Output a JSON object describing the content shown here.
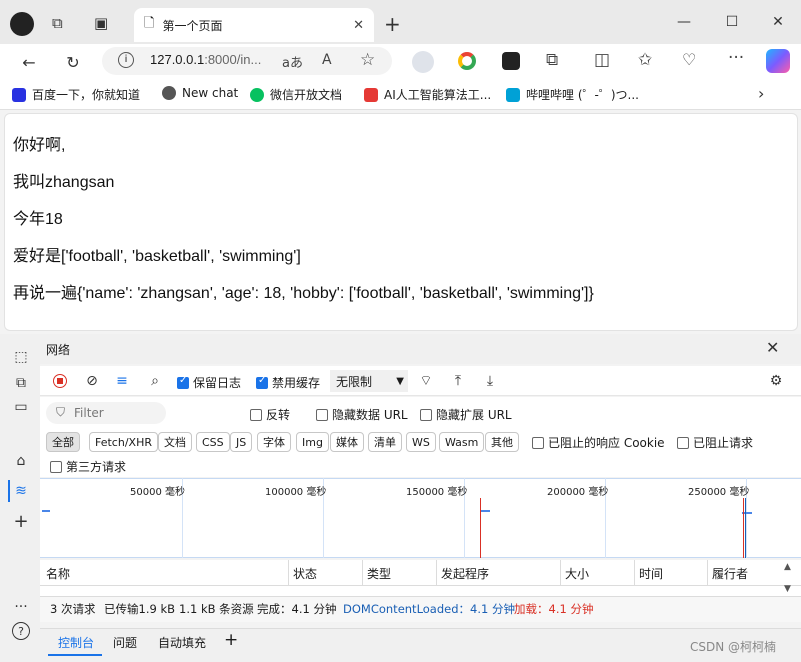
{
  "browser": {
    "tab_title": "第一个页面",
    "url_host": "127.0.0.1",
    "url_rest": ":8000/in...",
    "read_aloud_label": "aあ",
    "text_size_label": "A",
    "bookmarks": [
      {
        "label": "百度一下，你就知道",
        "color": "#2932e1"
      },
      {
        "label": "New chat",
        "color": "#555555"
      },
      {
        "label": "微信开放文档",
        "color": "#07c160"
      },
      {
        "label": "AI人工智能算法工...",
        "color": "#e53935"
      },
      {
        "label": "哔哩哔哩 (゜-゜)つ...",
        "color": "#00a1d6"
      }
    ]
  },
  "page": {
    "lines": [
      "你好啊,",
      "我叫zhangsan",
      "今年18",
      "爱好是['football', 'basketball', 'swimming']",
      "再说一遍{'name': 'zhangsan', 'age': 18, 'hobby': ['football', 'basketball', 'swimming']}"
    ]
  },
  "devtools": {
    "panel_title": "网络",
    "preserve_log": "保留日志",
    "disable_cache": "禁用缓存",
    "throttle": "无限制",
    "filter_placeholder": "Filter",
    "invert": "反转",
    "hide_data_url": "隐藏数据 URL",
    "hide_ext_url": "隐藏扩展 URL",
    "types": [
      "全部",
      "Fetch/XHR",
      "文档",
      "CSS",
      "JS",
      "字体",
      "Img",
      "媒体",
      "清单",
      "WS",
      "Wasm",
      "其他"
    ],
    "blocked_cookies": "已阻止的响应 Cookie",
    "blocked_requests": "已阻止请求",
    "third_party": "第三方请求",
    "timeline_ticks": [
      "50000 毫秒",
      "100000 毫秒",
      "150000 毫秒",
      "200000 毫秒",
      "250000 毫秒"
    ],
    "columns": [
      "名称",
      "状态",
      "类型",
      "发起程序",
      "大小",
      "时间",
      "履行者"
    ],
    "status": {
      "requests": "3 次请求",
      "transferred": "已传输1.9 kB",
      "resources": "1.1 kB 条资源",
      "finish": "完成：4.1 分钟",
      "dcl": "DOMContentLoaded：4.1 分钟",
      "load": "加载：4.1 分钟"
    },
    "drawer_tabs": [
      "控制台",
      "问题",
      "自动填充"
    ],
    "add_tab": "+"
  },
  "watermark": "CSDN @柯柯楠",
  "colors": {
    "accent": "#1a73e8",
    "dcl": "#1a5fb4",
    "load": "#d93025"
  }
}
